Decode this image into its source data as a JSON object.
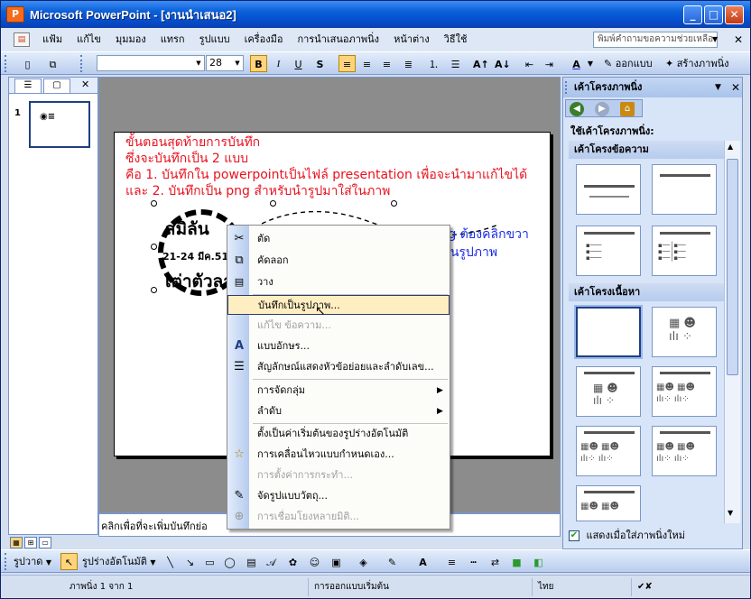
{
  "window": {
    "title": "Microsoft PowerPoint - [งานนำเสนอ2]",
    "min_label": "_",
    "max_label": "□",
    "close_label": "✕"
  },
  "menubar": {
    "items": [
      "แฟ้ม",
      "แก้ไข",
      "มุมมอง",
      "แทรก",
      "รูปแบบ",
      "เครื่องมือ",
      "การนำเสนอภาพนิ่ง",
      "หน้าต่าง",
      "วิธีใช้"
    ],
    "help_placeholder": "พิมพ์คำถามขอความช่วยเหลือ",
    "close_label": "✕"
  },
  "toolbar": {
    "font_name": "",
    "font_size": "28",
    "bold": "B",
    "italic": "I",
    "underline": "U",
    "shadow": "S",
    "font_color": "A",
    "design_label": "ออกแบบ",
    "new_slide_label": "สร้างภาพนิ่ง"
  },
  "slides_pane": {
    "tab_outline": "☰",
    "tab_slides": "▢",
    "close_label": "✕",
    "slide_number": "1"
  },
  "slide": {
    "annotation_lines": [
      "ขั้นตอนสุดท้ายการบันทึก",
      "ซึ่งจะบันทึกเป็น 2 แบบ",
      "คือ 1. บันทึกใน powerpointเป็นไฟล์  presentation เพื่อจะนำมาแก้ไขได้",
      "และ 2. บันทึกเป็น png  สำหรับนำรูปมาใส่ในภาพ"
    ],
    "hint_lines": [
      "การบันทึกเป็น png ต้องคลิกขวา",
      "เพื่อเข้า...บันทึกเป็นรูปภาพ"
    ],
    "stamp_top": "สมิลัน",
    "stamp_mid": "21-24  มีค.51",
    "stamp_bot": "เต่าตัวลาย"
  },
  "notes": {
    "placeholder": "คลิกเพื่อที่จะเพิ่มบันทึกย่อ"
  },
  "context_menu": {
    "items": [
      {
        "icon": "scissors-icon",
        "glyph": "✂",
        "label": "ตัด",
        "disabled": false
      },
      {
        "icon": "copy-icon",
        "glyph": "⧉",
        "label": "คัดลอก",
        "disabled": false
      },
      {
        "icon": "paste-icon",
        "glyph": "📋",
        "label": "วาง",
        "disabled": false
      },
      {
        "icon": "",
        "glyph": "",
        "label": "บันทึกเป็นรูปภาพ...",
        "disabled": false,
        "highlighted": true
      },
      {
        "icon": "",
        "glyph": "",
        "label": "แก้ไข ข้อความ...",
        "disabled": true
      },
      {
        "icon": "font-icon",
        "glyph": "A",
        "label": "แบบอักษร...",
        "disabled": false
      },
      {
        "icon": "bullets-icon",
        "glyph": "☰",
        "label": "สัญลักษณ์แสดงหัวข้อย่อยและลำดับเลข...",
        "disabled": false
      },
      {
        "icon": "",
        "glyph": "",
        "label": "การจัดกลุ่ม",
        "disabled": false,
        "submenu": true
      },
      {
        "icon": "",
        "glyph": "",
        "label": "ลำดับ",
        "disabled": false,
        "submenu": true
      },
      {
        "icon": "",
        "glyph": "",
        "label": "ตั้งเป็นค่าเริ่มต้นของรูปร่างอัตโนมัติ",
        "disabled": false
      },
      {
        "icon": "custom-animation-icon",
        "glyph": "☆",
        "label": "การเคลื่อนไหวแบบกำหนดเอง...",
        "disabled": false
      },
      {
        "icon": "",
        "glyph": "",
        "label": "การตั้งค่าการกระทำ...",
        "disabled": true
      },
      {
        "icon": "format-object-icon",
        "glyph": "🖌",
        "label": "จัดรูปแบบวัตถุ...",
        "disabled": false
      },
      {
        "icon": "hyperlink-icon",
        "glyph": "🌐",
        "label": "การเชื่อมโยงหลายมิติ...",
        "disabled": true
      }
    ]
  },
  "task_pane": {
    "title": "เค้าโครงภาพนิ่ง",
    "close_label": "✕",
    "apply_label": "ใช้เค้าโครงภาพนิ่ง:",
    "section_text": "เค้าโครงข้อความ",
    "section_content": "เค้าโครงเนื้อหา",
    "footer_label": "แสดงเมื่อใส่ภาพนิ่งใหม่"
  },
  "drawing_toolbar": {
    "draw_label": "รูปวาด",
    "autoshapes_label": "รูปร่างอัตโนมัติ"
  },
  "status_bar": {
    "slide_info": "ภาพนิ่ง 1 จาก 1",
    "design": "การออกแบบเริ่มต้น",
    "language": "ไทย"
  }
}
